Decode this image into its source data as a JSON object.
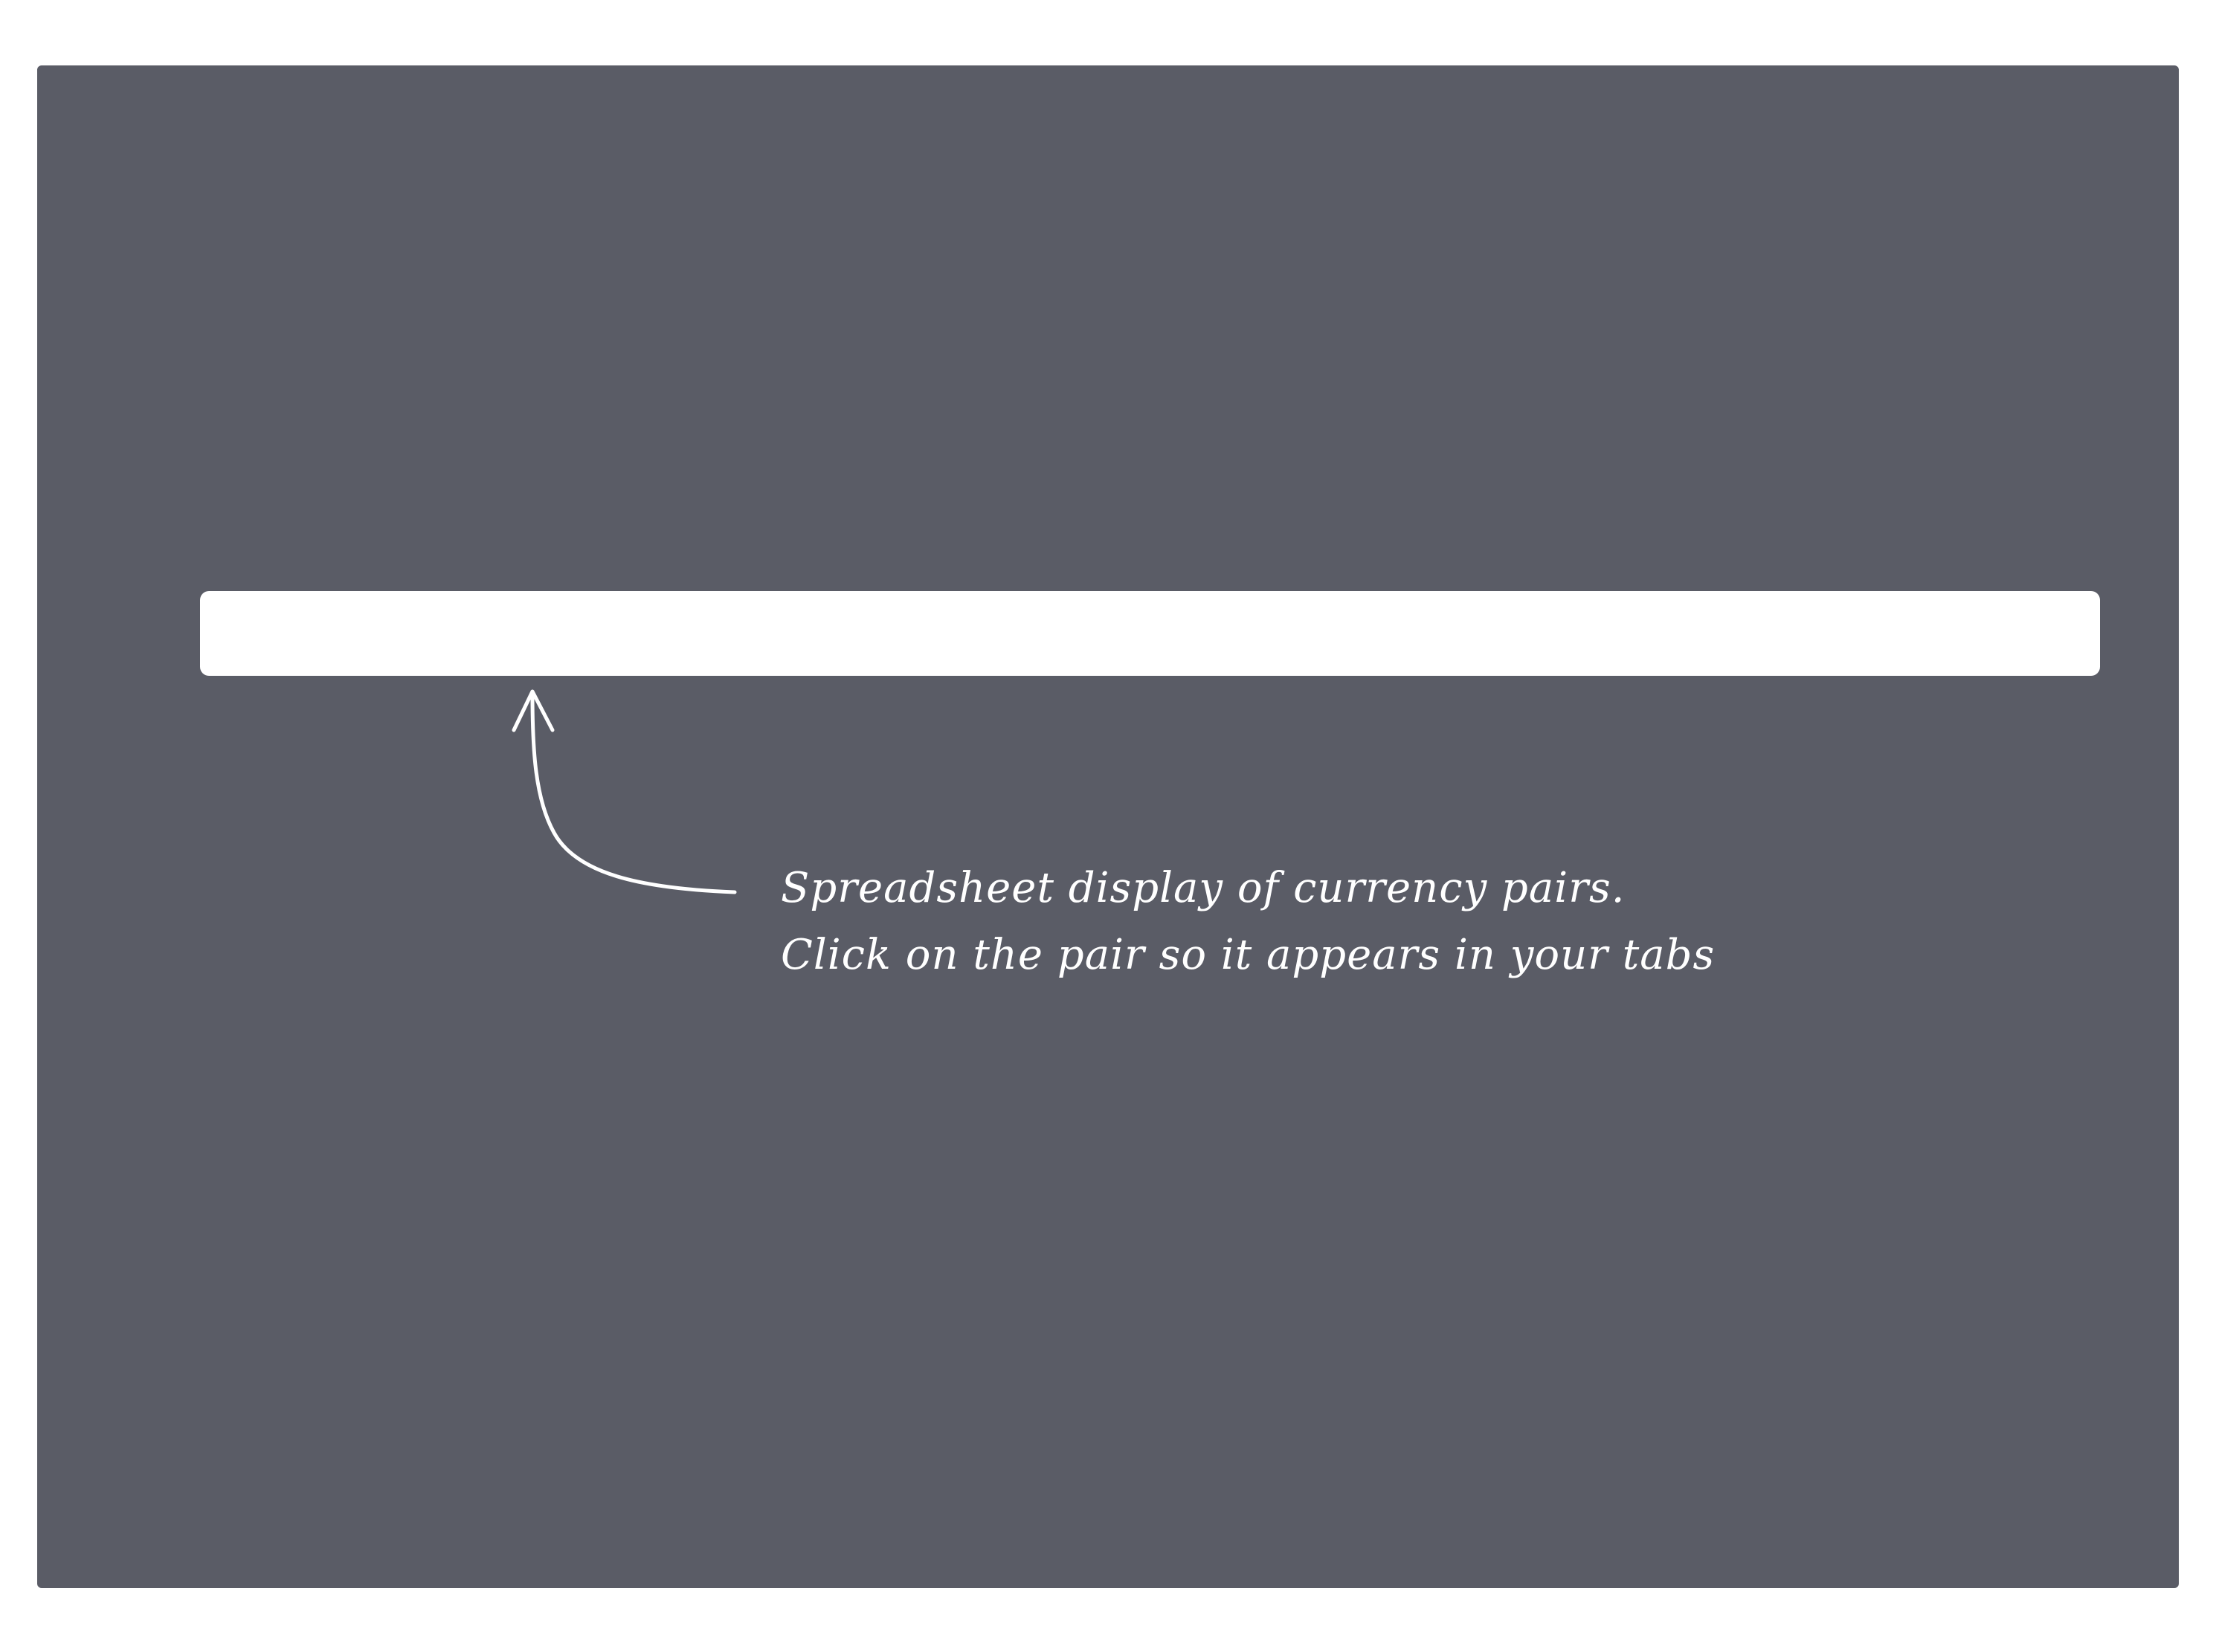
{
  "tutorial": {
    "note_line_1": "Spreadsheet display of currency pairs.",
    "note_line_2": "Click on the pair so it appears in your tabs",
    "pointer_icon": "curved-arrow-up-icon"
  },
  "colors": {
    "overlay": "#5a5c66",
    "highlight": "#ffffff",
    "text": "#ffffff",
    "page_background": "#ffffff"
  }
}
